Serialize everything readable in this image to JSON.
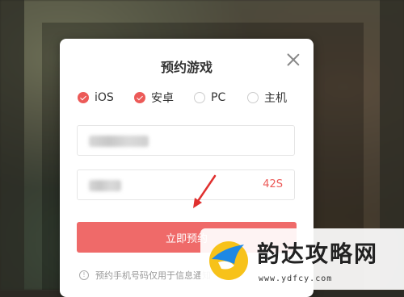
{
  "dialog": {
    "title": "预约游戏",
    "platforms": [
      {
        "label": "iOS",
        "checked": true
      },
      {
        "label": "安卓",
        "checked": true
      },
      {
        "label": "PC",
        "checked": false
      },
      {
        "label": "主机",
        "checked": false
      }
    ],
    "phone_field": {
      "value": "",
      "state": "blurred"
    },
    "code_field": {
      "value": "",
      "countdown": "42S"
    },
    "submit_label": "立即预约",
    "notice": "预约手机号码仅用于信息通知"
  },
  "watermark": {
    "brand": "韵达攻略网",
    "url": "www.ydfcy.com"
  },
  "colors": {
    "accent": "#ec5a58",
    "button": "#ef6a69"
  }
}
